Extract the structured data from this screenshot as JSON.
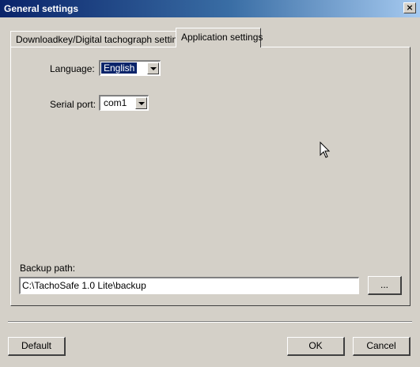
{
  "window": {
    "title": "General settings",
    "close_glyph": "×"
  },
  "tabs": [
    {
      "label": "Downloadkey/Digital tachograph settings",
      "active": false
    },
    {
      "label": "Application settings",
      "active": true
    }
  ],
  "language": {
    "label": "Language:",
    "value": "English"
  },
  "serial_port": {
    "label": "Serial port:",
    "value": "com1"
  },
  "backup": {
    "label": "Backup path:",
    "value": "C:\\TachoSafe 1.0 Lite\\backup",
    "browse_label": "..."
  },
  "buttons": {
    "default": "Default",
    "ok": "OK",
    "cancel": "Cancel"
  },
  "colors": {
    "titlebar": "#0a246a",
    "face": "#d4d0c8",
    "selection": "#0a246a"
  },
  "icons": {
    "cursor": "mouse-cursor-icon",
    "dropdown": "chevron-down-icon",
    "close": "close-icon"
  }
}
